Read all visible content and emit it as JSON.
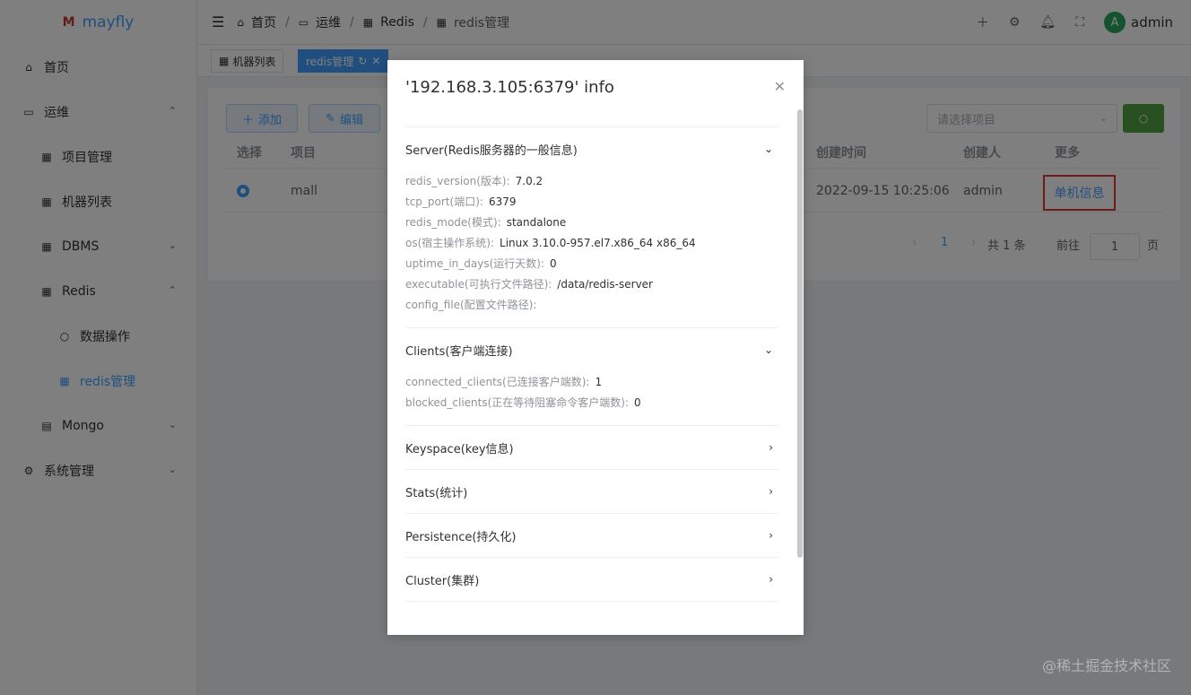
{
  "app": {
    "name": "mayfly",
    "logo_glyph": "M"
  },
  "sidebar": {
    "items": [
      {
        "label": "首页",
        "icon": "home-icon",
        "glyph": "⌂"
      },
      {
        "label": "运维",
        "icon": "monitor-icon",
        "glyph": "▭",
        "arrow": "⌃"
      },
      {
        "label": "项目管理",
        "icon": "grid-icon",
        "glyph": "▦"
      },
      {
        "label": "机器列表",
        "icon": "grid-icon",
        "glyph": "▦"
      },
      {
        "label": "DBMS",
        "icon": "grid-icon",
        "glyph": "▦",
        "arrow": "⌄"
      },
      {
        "label": "Redis",
        "icon": "grid-icon",
        "glyph": "▦",
        "arrow": "⌃"
      },
      {
        "label": "数据操作",
        "icon": "search-icon",
        "glyph": "○"
      },
      {
        "label": "redis管理",
        "icon": "grid-icon",
        "glyph": "▦"
      },
      {
        "label": "Mongo",
        "icon": "document-icon",
        "glyph": "▤",
        "arrow": "⌄"
      },
      {
        "label": "系统管理",
        "icon": "gear-icon",
        "glyph": "⚙",
        "arrow": "⌄"
      }
    ]
  },
  "header": {
    "breadcrumb": [
      "首页",
      "运维",
      "Redis",
      "redis管理"
    ],
    "separator": "/",
    "user": "admin",
    "avatar_letter": "A"
  },
  "tabs": [
    {
      "label": "机器列表"
    },
    {
      "label": "redis管理"
    }
  ],
  "toolbar": {
    "add_label": "添加",
    "edit_label": "编辑",
    "select_placeholder": "请选择项目"
  },
  "table": {
    "headers": [
      "选择",
      "项目",
      "创建时间",
      "创建人",
      "更多"
    ],
    "row": {
      "project": "mall",
      "created_at": "2022-09-15 10:25:06",
      "creator": "admin",
      "more": "单机信息"
    }
  },
  "pager": {
    "current": "1",
    "total": "共 1 条",
    "goto_label": "前往",
    "goto_value": "1",
    "page_suffix": "页"
  },
  "dialog": {
    "title": "'192.168.3.105:6379' info",
    "sections": [
      {
        "title": "Server(Redis服务器的一般信息)",
        "expanded": true,
        "items": [
          {
            "k": "redis_version(版本):",
            "v": "7.0.2"
          },
          {
            "k": "tcp_port(端口):",
            "v": "6379"
          },
          {
            "k": "redis_mode(模式):",
            "v": "standalone"
          },
          {
            "k": "os(宿主操作系统):",
            "v": "Linux 3.10.0-957.el7.x86_64 x86_64"
          },
          {
            "k": "uptime_in_days(运行天数):",
            "v": "0"
          },
          {
            "k": "executable(可执行文件路径):",
            "v": "/data/redis-server"
          },
          {
            "k": "config_file(配置文件路径):",
            "v": ""
          }
        ]
      },
      {
        "title": "Clients(客户端连接)",
        "expanded": true,
        "items": [
          {
            "k": "connected_clients(已连接客户端数):",
            "v": "1"
          },
          {
            "k": "blocked_clients(正在等待阻塞命令客户端数):",
            "v": "0"
          }
        ]
      },
      {
        "title": "Keyspace(key信息)",
        "expanded": false,
        "items": []
      },
      {
        "title": "Stats(统计)",
        "expanded": false,
        "items": []
      },
      {
        "title": "Persistence(持久化)",
        "expanded": false,
        "items": []
      },
      {
        "title": "Cluster(集群)",
        "expanded": false,
        "items": []
      }
    ]
  },
  "watermark": "@稀土掘金技术社区",
  "colors": {
    "primary": "#409eff",
    "success": "#52a043",
    "highlight_border": "#e03636"
  }
}
